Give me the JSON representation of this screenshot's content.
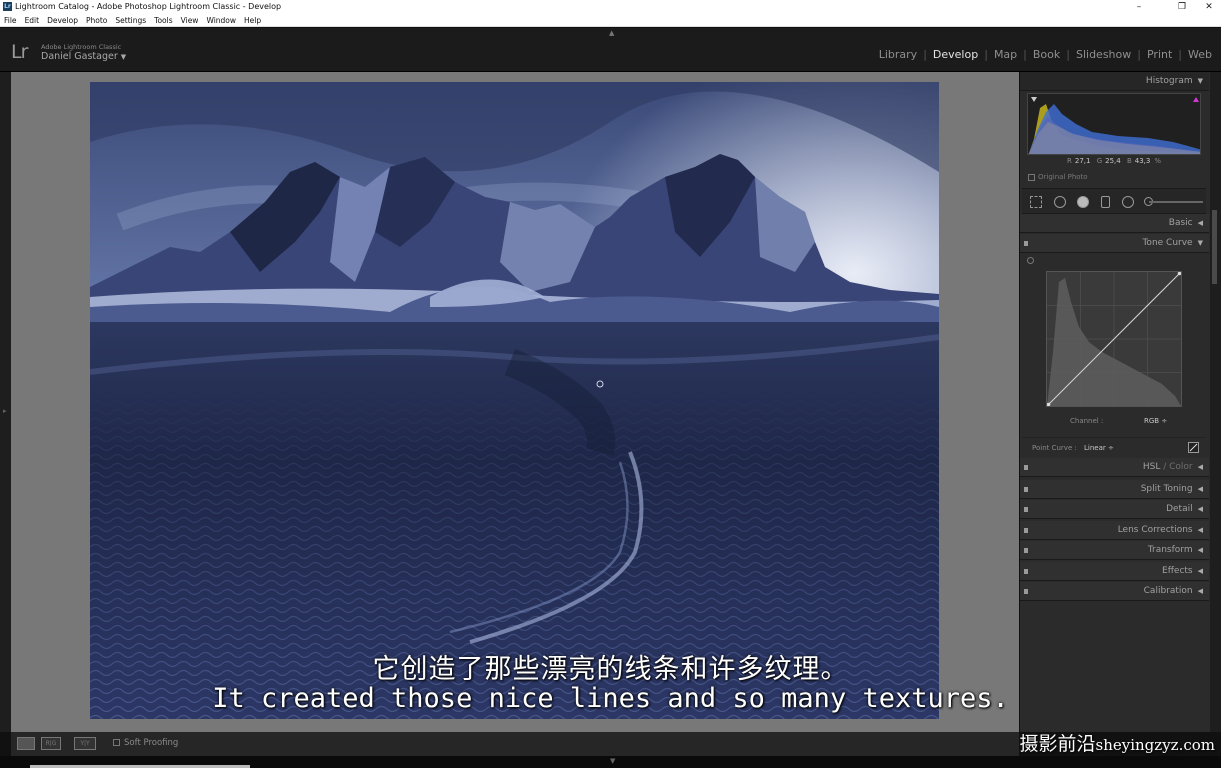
{
  "window": {
    "title": "Lightroom Catalog - Adobe Photoshop Lightroom Classic - Develop",
    "minimize": "–",
    "maximize": "❐",
    "close": "✕"
  },
  "menu": [
    "File",
    "Edit",
    "Develop",
    "Photo",
    "Settings",
    "Tools",
    "View",
    "Window",
    "Help"
  ],
  "identity": {
    "logo": "Lr",
    "product": "Adobe Lightroom Classic",
    "user": "Daniel Gastager"
  },
  "modules": [
    {
      "label": "Library",
      "active": false
    },
    {
      "label": "Develop",
      "active": true
    },
    {
      "label": "Map",
      "active": false
    },
    {
      "label": "Book",
      "active": false
    },
    {
      "label": "Slideshow",
      "active": false
    },
    {
      "label": "Print",
      "active": false
    },
    {
      "label": "Web",
      "active": false
    }
  ],
  "histogram": {
    "title": "Histogram",
    "r_label": "R",
    "r_value": "27,1",
    "g_label": "G",
    "g_value": "25,4",
    "b_label": "B",
    "b_value": "43,3",
    "unit": "%",
    "original_photo": "Original Photo"
  },
  "panels": {
    "basic": "Basic",
    "tone_curve": "Tone Curve",
    "channel_label": "Channel :",
    "channel_value": "RGB ÷",
    "point_curve_label": "Point Curve :",
    "point_curve_value": "Linear ÷",
    "hsl_1": "HSL",
    "hsl_sep": " / ",
    "hsl_2": "Color",
    "split_toning": "Split Toning",
    "detail": "Detail",
    "lens_corrections": "Lens Corrections",
    "transform": "Transform",
    "effects": "Effects",
    "calibration": "Calibration"
  },
  "toolbar": {
    "soft_proofing": "Soft Proofing",
    "view_loupe": "",
    "view_compare": "R|G",
    "view_survey": "Y|Y"
  },
  "subtitles": {
    "zh": "它创造了那些漂亮的线条和许多纹理。",
    "en": "It created those nice lines and so many textures."
  },
  "watermark": {
    "cn": "摄影前沿",
    "latin": "sheyingzyz.com"
  }
}
